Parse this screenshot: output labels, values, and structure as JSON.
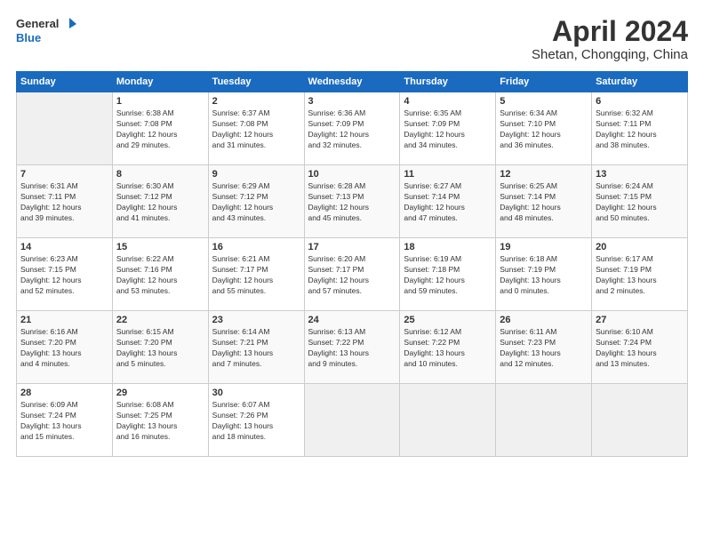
{
  "logo": {
    "general": "General",
    "blue": "Blue"
  },
  "header": {
    "title": "April 2024",
    "location": "Shetan, Chongqing, China"
  },
  "weekdays": [
    "Sunday",
    "Monday",
    "Tuesday",
    "Wednesday",
    "Thursday",
    "Friday",
    "Saturday"
  ],
  "weeks": [
    [
      {
        "day": "",
        "empty": true
      },
      {
        "day": "1",
        "sunrise": "6:38 AM",
        "sunset": "7:08 PM",
        "daylight": "12 hours and 29 minutes."
      },
      {
        "day": "2",
        "sunrise": "6:37 AM",
        "sunset": "7:08 PM",
        "daylight": "12 hours and 31 minutes."
      },
      {
        "day": "3",
        "sunrise": "6:36 AM",
        "sunset": "7:09 PM",
        "daylight": "12 hours and 32 minutes."
      },
      {
        "day": "4",
        "sunrise": "6:35 AM",
        "sunset": "7:09 PM",
        "daylight": "12 hours and 34 minutes."
      },
      {
        "day": "5",
        "sunrise": "6:34 AM",
        "sunset": "7:10 PM",
        "daylight": "12 hours and 36 minutes."
      },
      {
        "day": "6",
        "sunrise": "6:32 AM",
        "sunset": "7:11 PM",
        "daylight": "12 hours and 38 minutes."
      }
    ],
    [
      {
        "day": "7",
        "sunrise": "6:31 AM",
        "sunset": "7:11 PM",
        "daylight": "12 hours and 39 minutes."
      },
      {
        "day": "8",
        "sunrise": "6:30 AM",
        "sunset": "7:12 PM",
        "daylight": "12 hours and 41 minutes."
      },
      {
        "day": "9",
        "sunrise": "6:29 AM",
        "sunset": "7:12 PM",
        "daylight": "12 hours and 43 minutes."
      },
      {
        "day": "10",
        "sunrise": "6:28 AM",
        "sunset": "7:13 PM",
        "daylight": "12 hours and 45 minutes."
      },
      {
        "day": "11",
        "sunrise": "6:27 AM",
        "sunset": "7:14 PM",
        "daylight": "12 hours and 47 minutes."
      },
      {
        "day": "12",
        "sunrise": "6:25 AM",
        "sunset": "7:14 PM",
        "daylight": "12 hours and 48 minutes."
      },
      {
        "day": "13",
        "sunrise": "6:24 AM",
        "sunset": "7:15 PM",
        "daylight": "12 hours and 50 minutes."
      }
    ],
    [
      {
        "day": "14",
        "sunrise": "6:23 AM",
        "sunset": "7:15 PM",
        "daylight": "12 hours and 52 minutes."
      },
      {
        "day": "15",
        "sunrise": "6:22 AM",
        "sunset": "7:16 PM",
        "daylight": "12 hours and 53 minutes."
      },
      {
        "day": "16",
        "sunrise": "6:21 AM",
        "sunset": "7:17 PM",
        "daylight": "12 hours and 55 minutes."
      },
      {
        "day": "17",
        "sunrise": "6:20 AM",
        "sunset": "7:17 PM",
        "daylight": "12 hours and 57 minutes."
      },
      {
        "day": "18",
        "sunrise": "6:19 AM",
        "sunset": "7:18 PM",
        "daylight": "12 hours and 59 minutes."
      },
      {
        "day": "19",
        "sunrise": "6:18 AM",
        "sunset": "7:19 PM",
        "daylight": "13 hours and 0 minutes."
      },
      {
        "day": "20",
        "sunrise": "6:17 AM",
        "sunset": "7:19 PM",
        "daylight": "13 hours and 2 minutes."
      }
    ],
    [
      {
        "day": "21",
        "sunrise": "6:16 AM",
        "sunset": "7:20 PM",
        "daylight": "13 hours and 4 minutes."
      },
      {
        "day": "22",
        "sunrise": "6:15 AM",
        "sunset": "7:20 PM",
        "daylight": "13 hours and 5 minutes."
      },
      {
        "day": "23",
        "sunrise": "6:14 AM",
        "sunset": "7:21 PM",
        "daylight": "13 hours and 7 minutes."
      },
      {
        "day": "24",
        "sunrise": "6:13 AM",
        "sunset": "7:22 PM",
        "daylight": "13 hours and 9 minutes."
      },
      {
        "day": "25",
        "sunrise": "6:12 AM",
        "sunset": "7:22 PM",
        "daylight": "13 hours and 10 minutes."
      },
      {
        "day": "26",
        "sunrise": "6:11 AM",
        "sunset": "7:23 PM",
        "daylight": "13 hours and 12 minutes."
      },
      {
        "day": "27",
        "sunrise": "6:10 AM",
        "sunset": "7:24 PM",
        "daylight": "13 hours and 13 minutes."
      }
    ],
    [
      {
        "day": "28",
        "sunrise": "6:09 AM",
        "sunset": "7:24 PM",
        "daylight": "13 hours and 15 minutes."
      },
      {
        "day": "29",
        "sunrise": "6:08 AM",
        "sunset": "7:25 PM",
        "daylight": "13 hours and 16 minutes."
      },
      {
        "day": "30",
        "sunrise": "6:07 AM",
        "sunset": "7:26 PM",
        "daylight": "13 hours and 18 minutes."
      },
      {
        "day": "",
        "empty": true
      },
      {
        "day": "",
        "empty": true
      },
      {
        "day": "",
        "empty": true
      },
      {
        "day": "",
        "empty": true
      }
    ]
  ],
  "labels": {
    "sunrise": "Sunrise:",
    "sunset": "Sunset:",
    "daylight": "Daylight:"
  }
}
